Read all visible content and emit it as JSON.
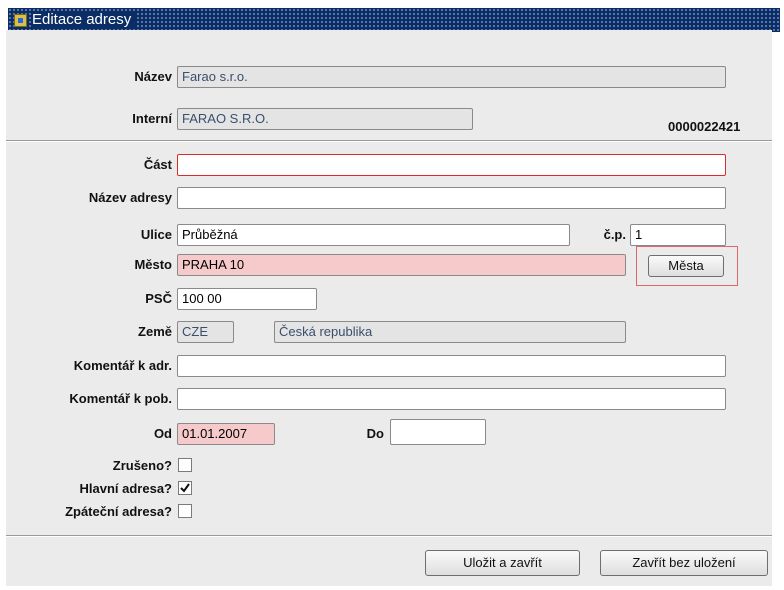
{
  "window": {
    "title": "Editace adresy"
  },
  "name_label": "Název",
  "name_value": "Farao s.r.o.",
  "internal_label": "Interní",
  "internal_value": "FARAO S.R.O.",
  "code": "0000022421",
  "part_label": "Část",
  "part_value": "",
  "address_name_label": "Název adresy",
  "address_name_value": "",
  "street_label": "Ulice",
  "street_value": "Průběžná",
  "cp_label": "č.p.",
  "cp_value": "1",
  "city_label": "Město",
  "city_value": "PRAHA 10",
  "cities_button": "Města",
  "zip_label": "PSČ",
  "zip_value": "100 00",
  "country_label": "Země",
  "country_code": "CZE",
  "country_name": "Česká republika",
  "comment_adr_label": "Komentář k adr.",
  "comment_adr_value": "",
  "comment_pob_label": "Komentář k pob.",
  "comment_pob_value": "",
  "from_label": "Od",
  "from_value": "01.01.2007",
  "to_label": "Do",
  "to_value": "",
  "checkboxes": [
    {
      "label": "Zrušeno?",
      "checked": false
    },
    {
      "label": "Hlavní adresa?",
      "checked": true
    },
    {
      "label": "Zpáteční adresa?",
      "checked": false
    }
  ],
  "save_close_button": "Uložit a zavřít",
  "close_no_save_button": "Zavřít bez uložení"
}
